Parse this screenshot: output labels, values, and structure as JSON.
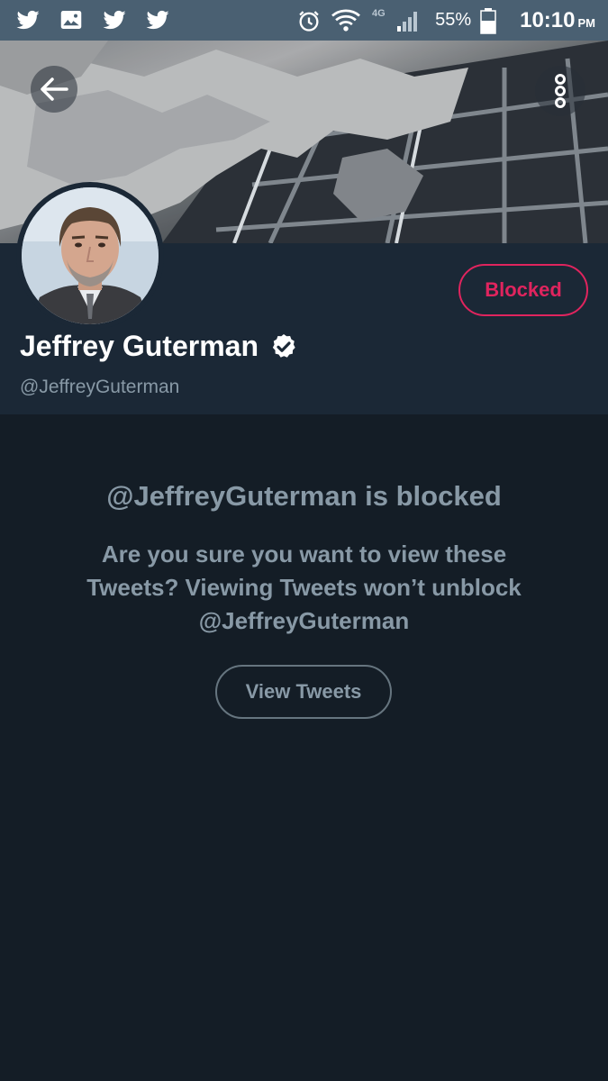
{
  "status_bar": {
    "left_icons": [
      "twitter-icon",
      "image-icon",
      "twitter-icon",
      "twitter-icon"
    ],
    "right_icons": [
      "alarm-icon",
      "wifi-icon",
      "signal-icon",
      "battery-icon"
    ],
    "network_label": "4G",
    "battery_percent": "55%",
    "time": "10:10",
    "ampm": "PM"
  },
  "banner": {
    "back_icon": "arrow-left-icon",
    "more_icon": "more-vertical-icon"
  },
  "profile": {
    "display_name": "Jeffrey Guterman",
    "verified_icon": "verified-badge-icon",
    "handle": "@JeffreyGuterman",
    "blocked_button_label": "Blocked"
  },
  "blocked_notice": {
    "title": "@JeffreyGuterman is blocked",
    "body": "Are you sure you want to view these Tweets? Viewing Tweets won’t unblock @JeffreyGuterman",
    "view_button_label": "View Tweets"
  },
  "colors": {
    "status_bar": "#4a6072",
    "header_bg": "#1b2836",
    "page_bg": "#141d26",
    "blocked_red": "#e0245e",
    "muted_text": "#8899a6"
  }
}
